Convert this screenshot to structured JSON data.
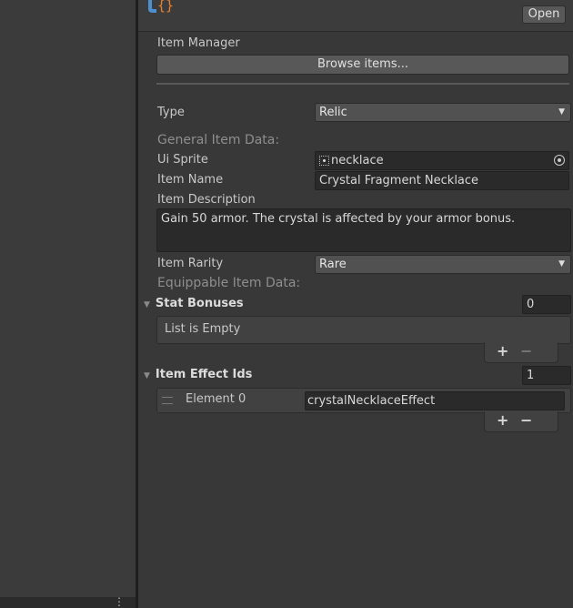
{
  "header": {
    "open_label": "Open"
  },
  "item_manager": {
    "label": "Item Manager",
    "browse_label": "Browse items..."
  },
  "type": {
    "label": "Type",
    "value": "Relic"
  },
  "general_section": "General Item Data:",
  "ui_sprite": {
    "label": "Ui Sprite",
    "value": "necklace"
  },
  "item_name": {
    "label": "Item Name",
    "value": "Crystal Fragment Necklace"
  },
  "item_description": {
    "label": "Item Description",
    "value": "Gain 50 armor. The crystal is affected by your armor bonus."
  },
  "item_rarity": {
    "label": "Item Rarity",
    "value": "Rare"
  },
  "equippable_section": "Equippable Item Data:",
  "stat_bonuses": {
    "label": "Stat Bonuses",
    "count": "0",
    "empty_text": "List is Empty",
    "plus": "+",
    "minus": "−"
  },
  "item_effect_ids": {
    "label": "Item Effect Ids",
    "count": "1",
    "elements": [
      {
        "label": "Element 0",
        "value": "crystalNecklaceEffect"
      }
    ],
    "plus": "+",
    "minus": "−"
  },
  "icons": {
    "script": "csharp-script-icon",
    "picker": "object-picker-icon",
    "sprite": "sprite-icon",
    "dropdown": "chevron-down-icon",
    "foldout": "triangle-down-icon",
    "drag": "drag-handle-icon",
    "menu": "kebab-menu-icon"
  },
  "colors": {
    "background": "#383838",
    "field": "#2a2a2a",
    "button": "#585858",
    "script_blue": "#4e8fd0",
    "script_orange": "#e8822e"
  }
}
